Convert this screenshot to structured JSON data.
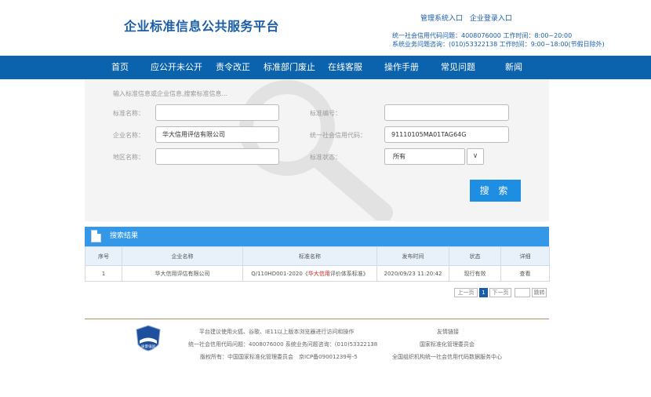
{
  "header": {
    "title": "企业标准信息公共服务平台",
    "admin_entry": "管理系统入口",
    "company_login": "企业登录入口",
    "contact_credit": "统一社会信用代码问题：4008076000 工作时间：8:00~20:00",
    "contact_business": "系统业务问题咨询：(010)53322138 工作时间：9:00~18:00(节假日除外)"
  },
  "nav": {
    "items": [
      "首页",
      "应公开未公开",
      "责令改正",
      "标准部门废止",
      "在线客服",
      "操作手册",
      "常见问题",
      "新闻"
    ]
  },
  "search": {
    "hint": "输入标准信息或企业信息,搜索标准信息...",
    "standard_name_label": "标准名称：",
    "standard_name_value": "",
    "standard_number_label": "标准编号：",
    "standard_number_value": "",
    "company_name_label": "企业名称：",
    "company_name_value": "华大信用评估有限公司",
    "credit_code_label": "统一社会信用代码：",
    "credit_code_value": "91110105MA01TAG64G",
    "region_label": "地区名称：",
    "region_value": "",
    "status_label": "标准状态：",
    "status_value": "所有",
    "button": "搜 索"
  },
  "results": {
    "title": "搜索结果",
    "columns": [
      "序号",
      "企业名称",
      "标准名称",
      "发布时间",
      "状态",
      "详细"
    ],
    "rows": [
      {
        "index": "1",
        "company": "华大信用评估有限公司",
        "standard_prefix": "Q/110HD001-2020《",
        "standard_highlight": "华大信用",
        "standard_suffix": "评价体系标准》",
        "published": "2020/09/23 11:20:42",
        "status": "现行有效",
        "detail": "查看"
      }
    ]
  },
  "pagination": {
    "prev": "上一页",
    "current": "1",
    "next": "下一页",
    "jump_value": "",
    "jump": "跳转"
  },
  "footer": {
    "emblem_text": "质量强国",
    "browser_note": "平台建议使用火狐、谷歌、IE11以上版本浏览器进行访问和操作",
    "contact": "统一社会信用代码问题：4008076000 系统业务问题咨询：(010)53322138",
    "copyright": "版权所有：中国国家标准化管理委员会　京ICP备09001239号-5",
    "friend_links_title": "友情链接",
    "link_1": "国家标准化管理委员会",
    "link_2": "全国组织机构统一社会信用代码数据服务中心"
  },
  "colors": {
    "brand_blue": "#0b63ae",
    "button_blue": "#1e8ee3",
    "highlight_red": "#d42323",
    "link_orange": "#e89a1a"
  }
}
